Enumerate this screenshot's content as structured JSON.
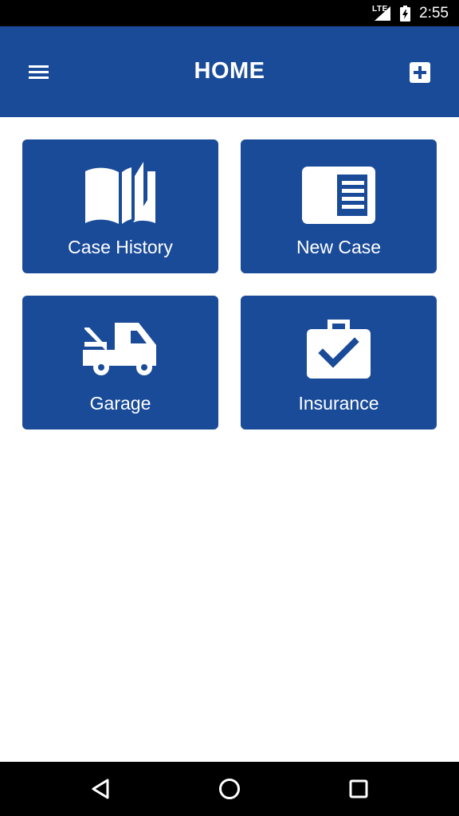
{
  "status_bar": {
    "network": "LTE",
    "time": "2:55"
  },
  "app_bar": {
    "title": "HOME",
    "menu_icon": "hamburger-menu-icon",
    "action_icon": "add-box-icon"
  },
  "tiles": [
    {
      "label": "Case History",
      "icon": "open-book-icon"
    },
    {
      "label": "New Case",
      "icon": "document-card-icon"
    },
    {
      "label": "Garage",
      "icon": "tow-truck-icon"
    },
    {
      "label": "Insurance",
      "icon": "briefcase-check-icon"
    }
  ],
  "nav_bar": {
    "back_icon": "back-triangle-icon",
    "home_icon": "home-circle-icon",
    "recents_icon": "recents-square-icon"
  },
  "colors": {
    "primary": "#1a4b99",
    "on_primary": "#ffffff",
    "background": "#ffffff",
    "system_bars": "#000000"
  }
}
